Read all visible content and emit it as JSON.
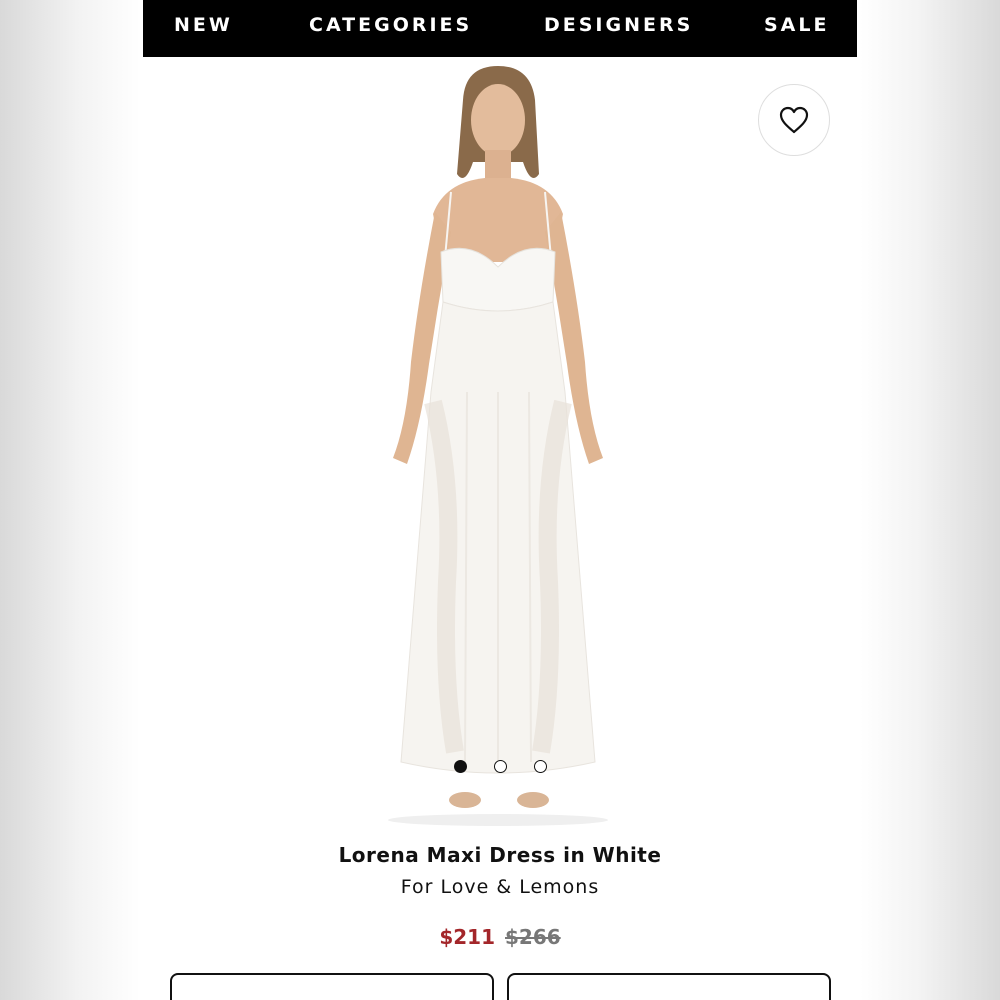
{
  "nav": {
    "items": [
      {
        "label": "NEW"
      },
      {
        "label": "CATEGORIES"
      },
      {
        "label": "DESIGNERS"
      },
      {
        "label": "SALE"
      }
    ]
  },
  "wishlist": {
    "icon": "heart-icon"
  },
  "gallery": {
    "total_images": 3,
    "active_index": 0
  },
  "product": {
    "name": "Lorena Maxi Dress in White",
    "brand": "For Love & Lemons",
    "sale_price": "$211",
    "original_price": "$266",
    "sale_color": "#a3262a"
  }
}
